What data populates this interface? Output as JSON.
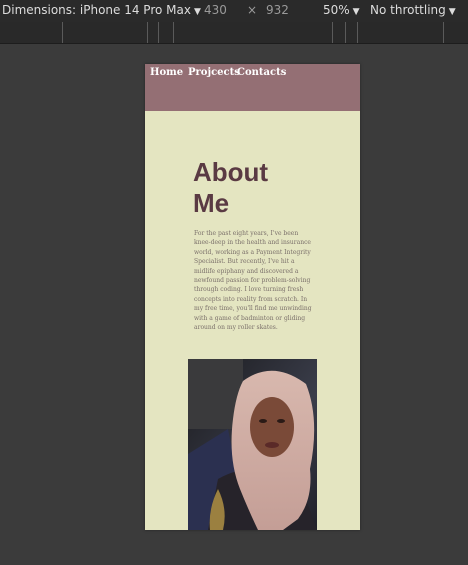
{
  "devtools": {
    "device_label": "Dimensions: iPhone 14 Pro Max",
    "width": "430",
    "separator": "×",
    "height": "932",
    "zoom": "50%",
    "throttling": "No throttling",
    "caret": "▼"
  },
  "site": {
    "nav": [
      "Home",
      "Projcects",
      "Contacts"
    ],
    "title_line1": "About",
    "title_line2": "Me",
    "bio": "For the past eight years, I've been knee-deep in the health and insurance world, working as a Payment Integrity Specialist. But recently, I've hit a midlife epiphany and discovered a newfound passion for problem-solving through coding. I love turning fresh concepts into reality from scratch. In my free time, you'll find me unwinding with a game of badminton or gliding around on my roller skates.",
    "photo_icon": "portrait-photo"
  }
}
